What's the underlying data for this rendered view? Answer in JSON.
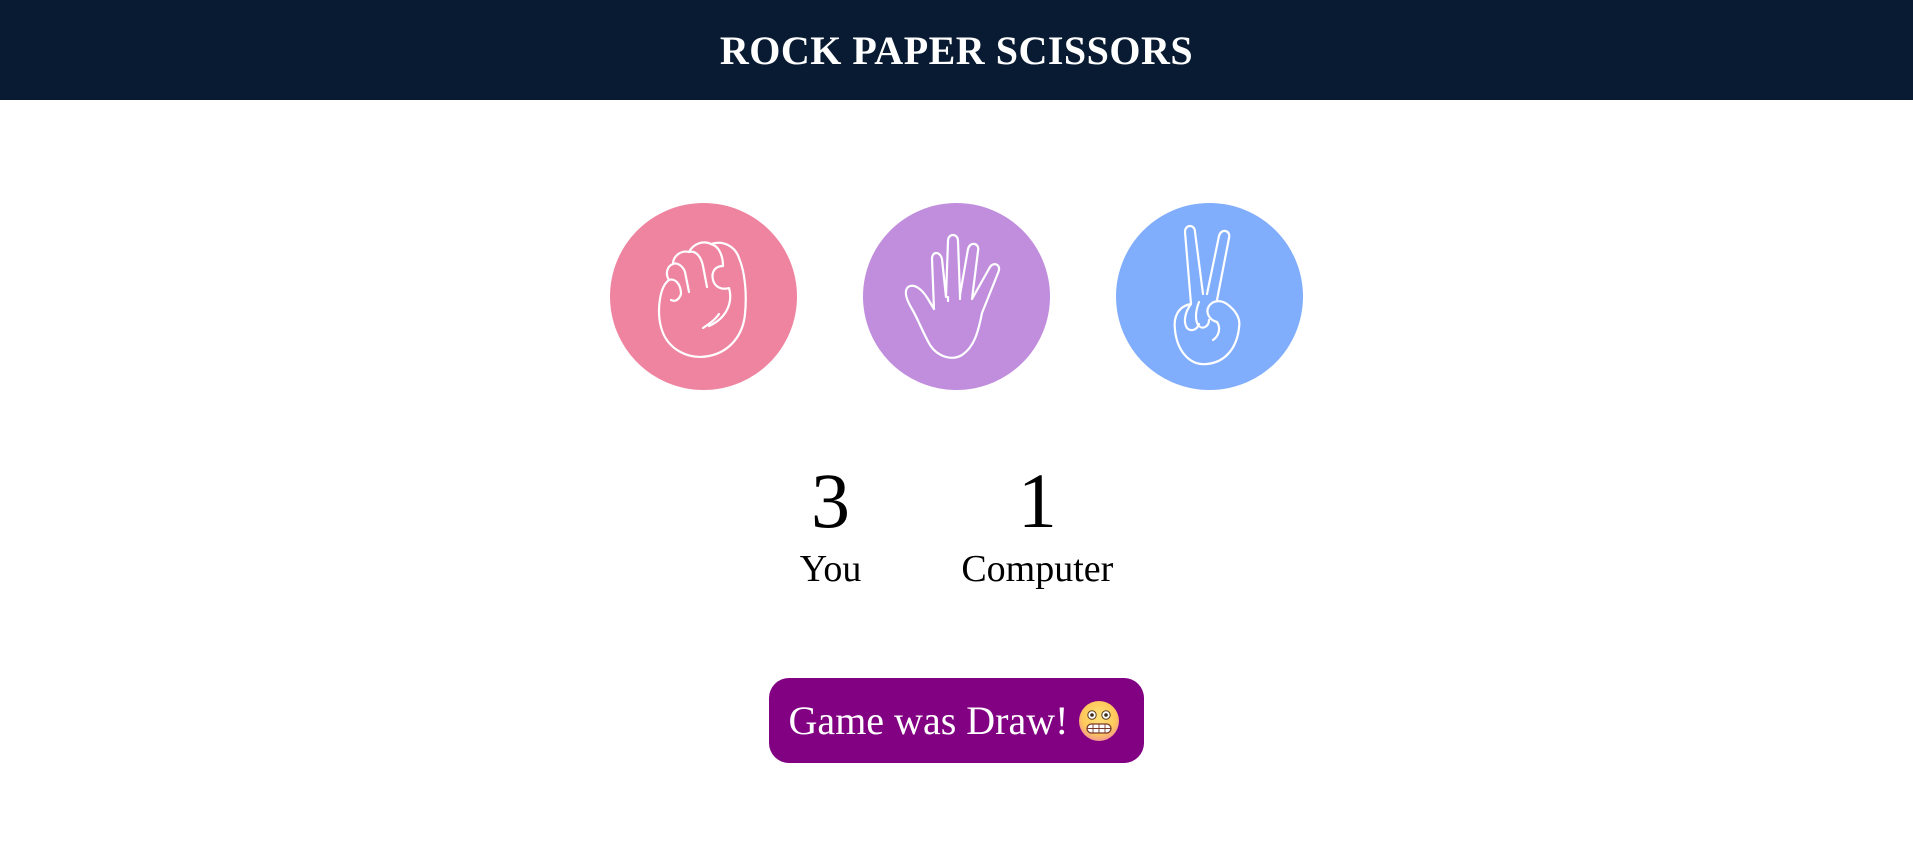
{
  "header": {
    "title": "ROCK PAPER SCISSORS",
    "bg": "#081b33"
  },
  "choices": [
    {
      "id": "rock",
      "icon": "fist-icon",
      "color": "#ef84a1"
    },
    {
      "id": "paper",
      "icon": "open-hand-icon",
      "color": "#c18edd"
    },
    {
      "id": "scissors",
      "icon": "peace-hand-icon",
      "color": "#80adfc"
    }
  ],
  "scores": {
    "user": {
      "value": "3",
      "label": "You"
    },
    "computer": {
      "value": "1",
      "label": "Computer"
    }
  },
  "message": {
    "text": "Game was Draw!",
    "icon": "grimacing-face-emoji",
    "bg": "#820182"
  }
}
